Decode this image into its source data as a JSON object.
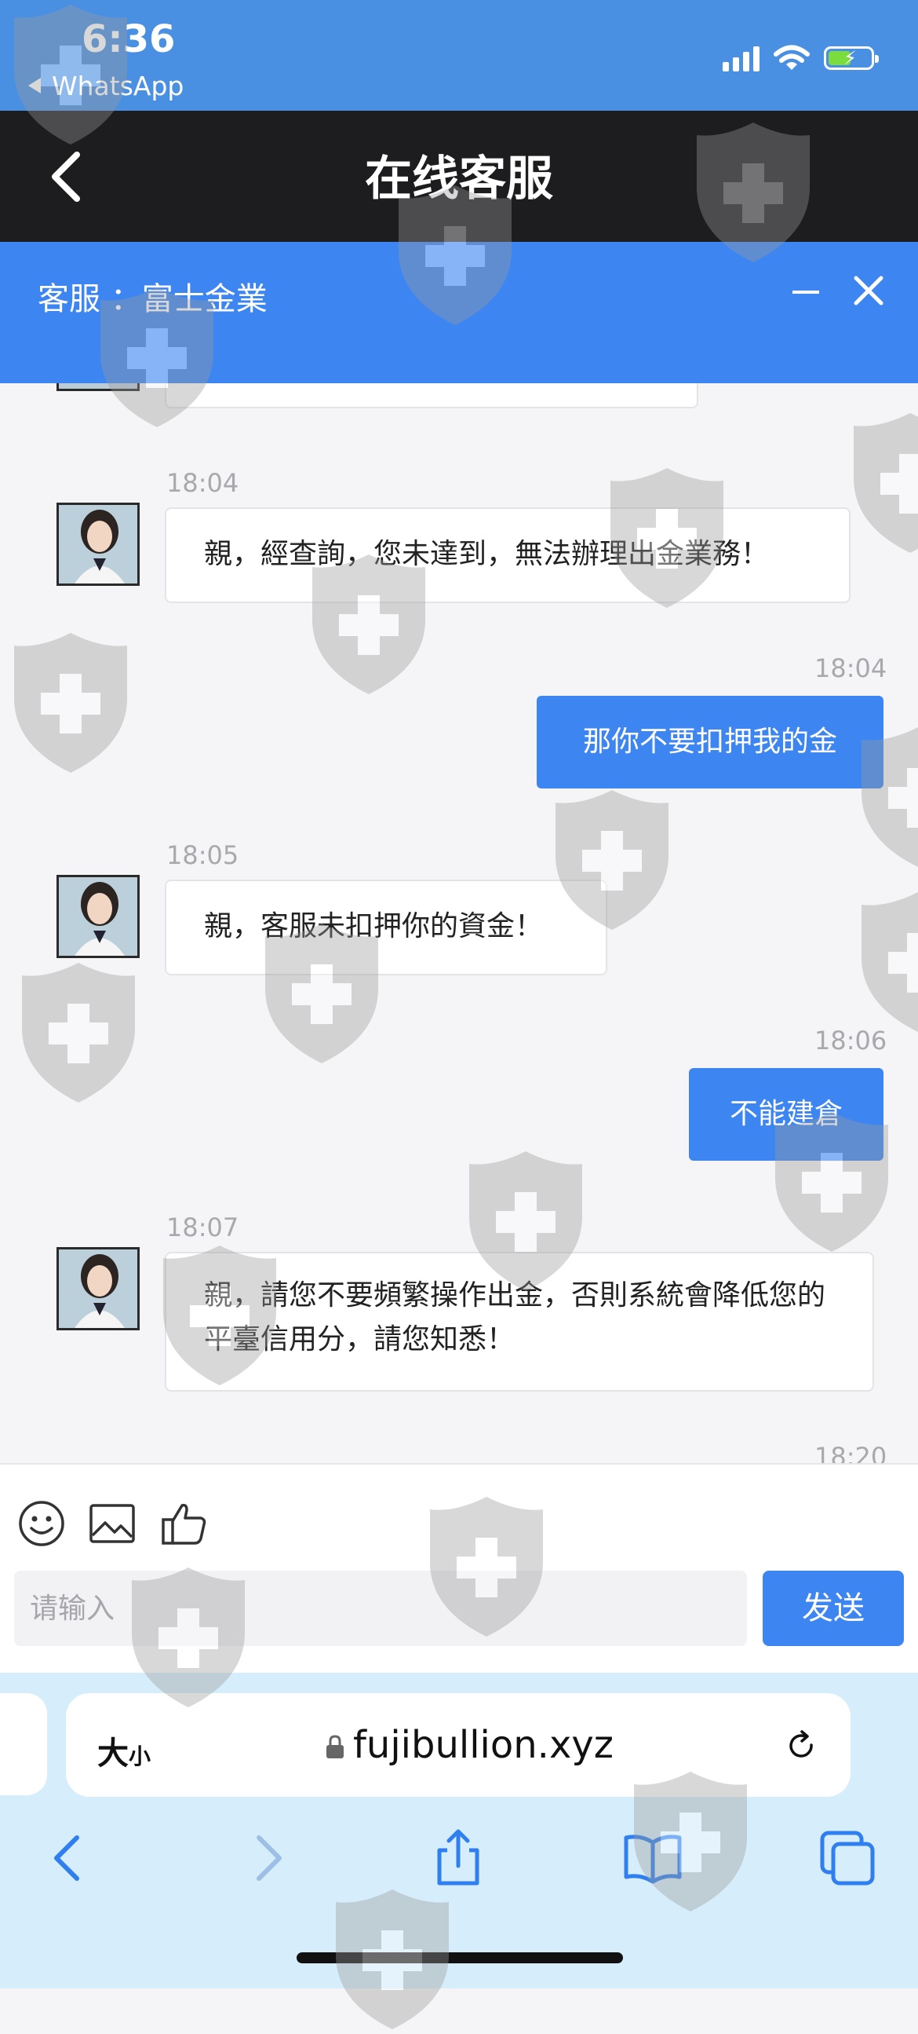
{
  "status_bar": {
    "time": "6:36",
    "back_app": "WhatsApp",
    "icons": [
      "signal-icon",
      "wifi-icon",
      "battery-charging-icon"
    ]
  },
  "title_bar": {
    "title": "在线客服",
    "back_icon": "chevron-left-icon"
  },
  "chat_header": {
    "agent_label": "客服 ：富士金業",
    "minimize_icon": "minus-icon",
    "close_icon": "close-icon"
  },
  "messages": [
    {
      "side": "in",
      "time": "18:04",
      "text": "親，經查詢，您未達到，無法辦理出金業務！"
    },
    {
      "side": "out",
      "time": "18:04",
      "text": "那你不要扣押我的金"
    },
    {
      "side": "in",
      "time": "18:05",
      "text": "親，客服未扣押你的資金！"
    },
    {
      "side": "out",
      "time": "18:06",
      "text": "不能建倉"
    },
    {
      "side": "in",
      "time": "18:07",
      "text": "親，請您不要頻繁操作出金，否則系統會降低您的平臺信用分，請您知悉！"
    },
    {
      "side": "out",
      "time": "18:20",
      "text": ""
    }
  ],
  "input_bar": {
    "tools": [
      "emoji-icon",
      "image-icon",
      "thumbs-up-icon"
    ],
    "placeholder": "请输入",
    "send_label": "发送"
  },
  "safari": {
    "text_size_big": "大",
    "text_size_small": "小",
    "url": "fujibullion.xyz",
    "nav_icons": [
      "back-icon",
      "forward-icon",
      "share-icon",
      "bookmarks-icon",
      "tabs-icon"
    ]
  },
  "colors": {
    "status_bar": "#4a90e2",
    "title_bar": "#1d1d20",
    "chat_header": "#3d86f2",
    "outgoing_bubble": "#3d86f2",
    "safari_bar": "#d6edfb"
  }
}
